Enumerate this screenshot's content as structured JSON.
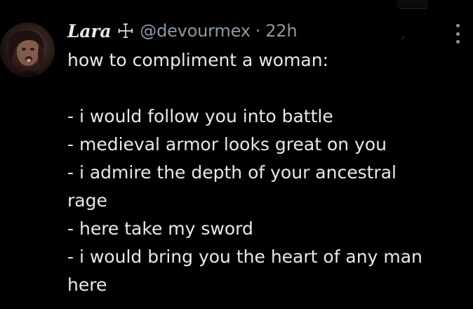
{
  "tweet": {
    "display_name": "Lara",
    "name_symbol": "☩",
    "handle": "@devourmex",
    "separator": "·",
    "time": "22h",
    "lines": [
      "how to compliment a woman:",
      "",
      "- i would follow you into battle",
      "- medieval armor looks great on you",
      "- i admire the depth of your ancestral",
      "rage",
      "- here take my sword",
      "- i would bring you the heart of any man",
      "here"
    ]
  },
  "icons": {
    "more": "more-options-icon",
    "avatar": "profile-avatar"
  },
  "colors": {
    "background": "#000000",
    "text_primary": "#e7e9ea",
    "text_secondary": "#8b98a5"
  }
}
